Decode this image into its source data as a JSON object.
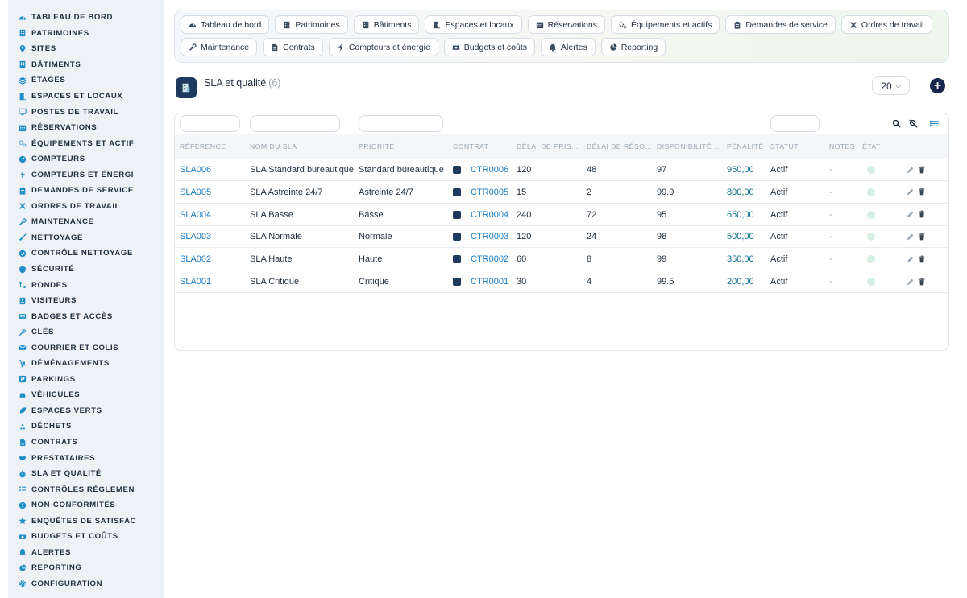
{
  "sidebar": {
    "items": [
      {
        "label": "Tableau de bord",
        "icon": "dashboard-icon"
      },
      {
        "label": "Patrimoines",
        "icon": "building-icon"
      },
      {
        "label": "Sites",
        "icon": "map-pin-icon"
      },
      {
        "label": "Bâtiments",
        "icon": "building-icon"
      },
      {
        "label": "Étages",
        "icon": "layers-icon"
      },
      {
        "label": "Espaces et locaux",
        "icon": "door-icon"
      },
      {
        "label": "Postes de travail",
        "icon": "monitor-icon"
      },
      {
        "label": "Réservations",
        "icon": "calendar-icon"
      },
      {
        "label": "Équipements et actif",
        "icon": "gears-icon"
      },
      {
        "label": "Compteurs",
        "icon": "meter-icon"
      },
      {
        "label": "Compteurs et énergi",
        "icon": "bolt-icon"
      },
      {
        "label": "Demandes de service",
        "icon": "clipboard-icon"
      },
      {
        "label": "Ordres de travail",
        "icon": "tools-icon"
      },
      {
        "label": "Maintenance",
        "icon": "wrench-icon"
      },
      {
        "label": "Nettoyage",
        "icon": "broom-icon"
      },
      {
        "label": "Contrôle nettoyage",
        "icon": "check-badge-icon"
      },
      {
        "label": "Sécurité",
        "icon": "shield-icon"
      },
      {
        "label": "Rondes",
        "icon": "route-icon"
      },
      {
        "label": "Visiteurs",
        "icon": "id-card-icon"
      },
      {
        "label": "Badges et accès",
        "icon": "badge-icon"
      },
      {
        "label": "Clés",
        "icon": "key-icon"
      },
      {
        "label": "Courrier et colis",
        "icon": "envelope-icon"
      },
      {
        "label": "Déménagements",
        "icon": "dolly-icon"
      },
      {
        "label": "Parkings",
        "icon": "parking-icon"
      },
      {
        "label": "Véhicules",
        "icon": "car-icon"
      },
      {
        "label": "Espaces verts",
        "icon": "leaf-icon"
      },
      {
        "label": "Déchets",
        "icon": "recycle-icon"
      },
      {
        "label": "Contrats",
        "icon": "file-icon"
      },
      {
        "label": "Prestataires",
        "icon": "handshake-icon"
      },
      {
        "label": "SLA et qualité",
        "icon": "stopwatch-icon"
      },
      {
        "label": "Contrôles réglemen",
        "icon": "list-check-icon"
      },
      {
        "label": "Non-conformités",
        "icon": "alert-circle-icon"
      },
      {
        "label": "Enquêtes de satisfac",
        "icon": "star-icon"
      },
      {
        "label": "Budgets et coûts",
        "icon": "money-icon"
      },
      {
        "label": "Alertes",
        "icon": "bell-icon"
      },
      {
        "label": "Reporting",
        "icon": "chart-pie-icon"
      },
      {
        "label": "Configuration",
        "icon": "gear-icon"
      }
    ]
  },
  "topnav": {
    "row1": [
      {
        "label": "Tableau de bord",
        "icon": "dashboard-icon"
      },
      {
        "label": "Patrimoines",
        "icon": "building-icon"
      },
      {
        "label": "Bâtiments",
        "icon": "building-icon"
      },
      {
        "label": "Espaces et locaux",
        "icon": "door-icon"
      },
      {
        "label": "Réservations",
        "icon": "calendar-icon"
      },
      {
        "label": "Équipements et actifs",
        "icon": "gears-icon"
      },
      {
        "label": "Demandes de service",
        "icon": "clipboard-icon"
      },
      {
        "label": "Ordres de travail",
        "icon": "tools-icon"
      }
    ],
    "row2": [
      {
        "label": "Maintenance",
        "icon": "wrench-icon"
      },
      {
        "label": "Contrats",
        "icon": "file-icon"
      },
      {
        "label": "Compteurs et énergie",
        "icon": "bolt-icon"
      },
      {
        "label": "Budgets et coûts",
        "icon": "money-icon"
      },
      {
        "label": "Alertes",
        "icon": "bell-icon"
      },
      {
        "label": "Reporting",
        "icon": "chart-pie-icon"
      }
    ]
  },
  "page": {
    "title": "SLA et qualité",
    "count": "(6)",
    "per_page": "20",
    "add_symbol": "+"
  },
  "table": {
    "columns": [
      "Référence",
      "Nom du SLA",
      "Priorité",
      "Contrat",
      "Délai de pris...",
      "Délai de réso...",
      "Disponibilité ...",
      "Pénalité",
      "Statut",
      "Notes",
      "État"
    ],
    "rows": [
      {
        "ref": "SLA006",
        "name": "SLA Standard bureautique",
        "priority": "Standard bureautique",
        "contract": "CTR0006",
        "take": "120",
        "resolve": "48",
        "avail": "97",
        "penalty": "950,00",
        "status": "Actif",
        "notes": "-"
      },
      {
        "ref": "SLA005",
        "name": "SLA Astreinte 24/7",
        "priority": "Astreinte 24/7",
        "contract": "CTR0005",
        "take": "15",
        "resolve": "2",
        "avail": "99.9",
        "penalty": "800,00",
        "status": "Actif",
        "notes": "-"
      },
      {
        "ref": "SLA004",
        "name": "SLA Basse",
        "priority": "Basse",
        "contract": "CTR0004",
        "take": "240",
        "resolve": "72",
        "avail": "95",
        "penalty": "650,00",
        "status": "Actif",
        "notes": "-"
      },
      {
        "ref": "SLA003",
        "name": "SLA Normale",
        "priority": "Normale",
        "contract": "CTR0003",
        "take": "120",
        "resolve": "24",
        "avail": "98",
        "penalty": "500,00",
        "status": "Actif",
        "notes": "-"
      },
      {
        "ref": "SLA002",
        "name": "SLA Haute",
        "priority": "Haute",
        "contract": "CTR0002",
        "take": "60",
        "resolve": "8",
        "avail": "99",
        "penalty": "350,00",
        "status": "Actif",
        "notes": "-"
      },
      {
        "ref": "SLA001",
        "name": "SLA Critique",
        "priority": "Critique",
        "contract": "CTR0001",
        "take": "30",
        "resolve": "4",
        "avail": "99.5",
        "penalty": "200,00",
        "status": "Actif",
        "notes": "-"
      }
    ]
  },
  "colors": {
    "accent": "#1a7bc4",
    "sidebar_bg": "#eef1f6",
    "dark_navy": "#16264d",
    "status_dot": "#d4f0e3"
  }
}
